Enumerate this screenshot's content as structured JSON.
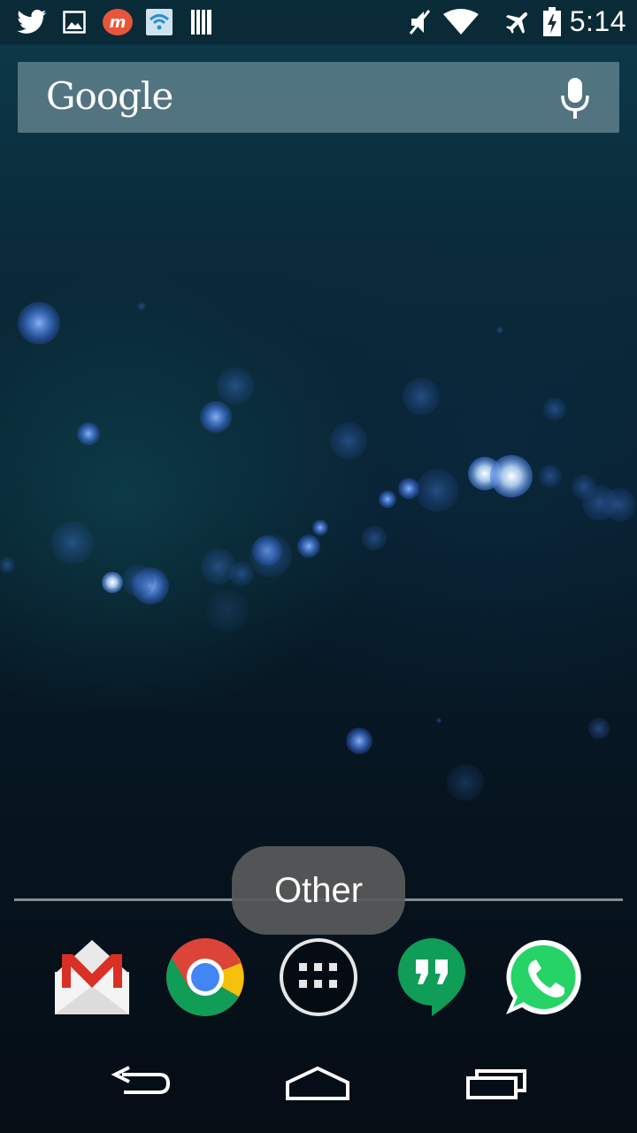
{
  "status_bar": {
    "time": "5:14",
    "icons": [
      "twitter-icon",
      "image-icon",
      "app-m-icon",
      "wifi-app-icon",
      "barcode-icon",
      "mute-icon",
      "wifi-icon",
      "airplane-icon",
      "battery-charging-icon"
    ]
  },
  "search": {
    "logo_text": "Google",
    "mic_icon": "microphone-icon"
  },
  "folder": {
    "label": "Other"
  },
  "dock": {
    "apps": [
      "Gmail",
      "Chrome",
      "All apps",
      "Hangouts",
      "WhatsApp"
    ]
  },
  "navigation": {
    "back": "back-icon",
    "home": "home-icon",
    "recents": "recents-icon"
  },
  "colors": {
    "gmail_red": "#d93025",
    "chrome_red": "#db4437",
    "chrome_yellow": "#f4c20d",
    "chrome_green": "#0f9d58",
    "chrome_blue": "#4285f4",
    "hangouts_green": "#0f9d58",
    "whatsapp_green": "#25d366"
  }
}
